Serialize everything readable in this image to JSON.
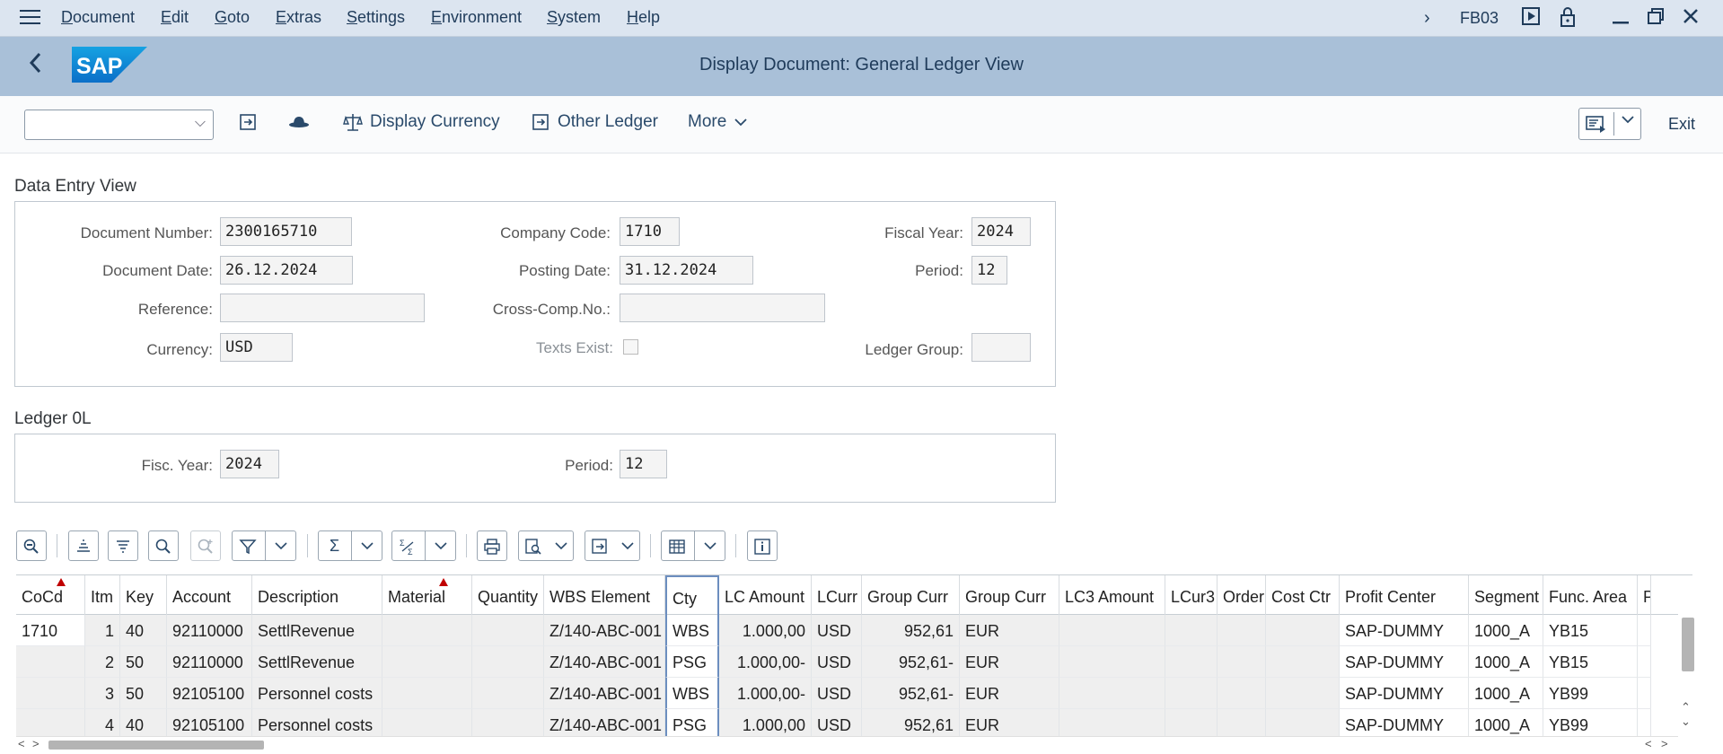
{
  "menu": {
    "items": [
      "Document",
      "Edit",
      "Goto",
      "Extras",
      "Settings",
      "Environment",
      "System",
      "Help"
    ],
    "tcode": "FB03"
  },
  "titlebar": {
    "title": "Display Document: General Ledger View",
    "logo_text": "SAP"
  },
  "toolbar": {
    "display_currency": "Display Currency",
    "other_ledger": "Other Ledger",
    "more": "More",
    "exit": "Exit"
  },
  "data_entry": {
    "section_title": "Data Entry View",
    "document_number_label": "Document Number:",
    "document_number": "2300165710",
    "company_code_label": "Company Code:",
    "company_code": "1710",
    "fiscal_year_label": "Fiscal Year:",
    "fiscal_year": "2024",
    "document_date_label": "Document Date:",
    "document_date": "26.12.2024",
    "posting_date_label": "Posting Date:",
    "posting_date": "31.12.2024",
    "period_label": "Period:",
    "period": "12",
    "reference_label": "Reference:",
    "reference": "",
    "cross_comp_label": "Cross-Comp.No.:",
    "cross_comp": "",
    "currency_label": "Currency:",
    "currency": "USD",
    "texts_exist_label": "Texts Exist:",
    "texts_exist": false,
    "ledger_group_label": "Ledger Group:",
    "ledger_group": ""
  },
  "ledger": {
    "section_title": "Ledger 0L",
    "fisc_year_label": "Fisc. Year:",
    "fisc_year": "2024",
    "period_label": "Period:",
    "period": "12"
  },
  "grid": {
    "columns": [
      "CoCd",
      "Itm",
      "Key",
      "Account",
      "Description",
      "Material",
      "Quantity",
      "WBS Element",
      "Cty",
      "LC Amount",
      "LCurr",
      "Group Curr",
      "Group Curr",
      "LC3 Amount",
      "LCur3",
      "Order",
      "Cost Ctr",
      "Profit Center",
      "Segment",
      "Func. Area",
      "P"
    ],
    "rows": [
      [
        "1710",
        "1",
        "40",
        "92110000",
        "SettlRevenue",
        "",
        "",
        "Z/140-ABC-001",
        "WBS",
        "1.000,00",
        "USD",
        "952,61",
        "EUR",
        "",
        "",
        "",
        "",
        "SAP-DUMMY",
        "1000_A",
        "YB15",
        ""
      ],
      [
        "",
        "2",
        "50",
        "92110000",
        "SettlRevenue",
        "",
        "",
        "Z/140-ABC-001",
        "PSG",
        "1.000,00-",
        "USD",
        "952,61-",
        "EUR",
        "",
        "",
        "",
        "",
        "SAP-DUMMY",
        "1000_A",
        "YB15",
        ""
      ],
      [
        "",
        "3",
        "50",
        "92105100",
        "Personnel costs",
        "",
        "",
        "Z/140-ABC-001",
        "WBS",
        "1.000,00-",
        "USD",
        "952,61-",
        "EUR",
        "",
        "",
        "",
        "",
        "SAP-DUMMY",
        "1000_A",
        "YB99",
        ""
      ],
      [
        "",
        "4",
        "40",
        "92105100",
        "Personnel costs",
        "",
        "",
        "Z/140-ABC-001",
        "PSG",
        "1.000,00",
        "USD",
        "952,61",
        "EUR",
        "",
        "",
        "",
        "",
        "SAP-DUMMY",
        "1000_A",
        "YB99",
        ""
      ]
    ]
  }
}
